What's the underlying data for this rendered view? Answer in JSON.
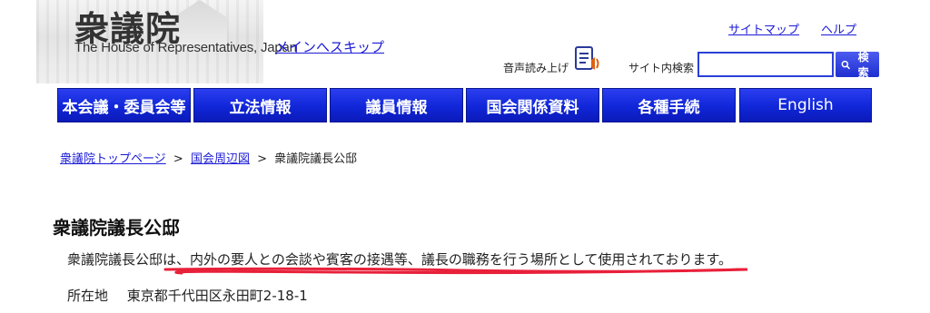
{
  "header": {
    "logo_kanji": "衆議院",
    "logo_en": "The House of Representatives, Japan",
    "skip_link": "メインへスキップ",
    "sitemap": "サイトマップ",
    "help": "ヘルプ",
    "speech_label": "音声読み上げ",
    "search_label": "サイト内検索",
    "search_value": "",
    "search_button": "検索"
  },
  "nav": {
    "items": [
      {
        "label": "本会議・委員会等"
      },
      {
        "label": "立法情報"
      },
      {
        "label": "議員情報"
      },
      {
        "label": "国会関係資料"
      },
      {
        "label": "各種手続"
      },
      {
        "label": "English"
      }
    ]
  },
  "breadcrumb": {
    "items": [
      "衆議院トップページ",
      "国会周辺図"
    ],
    "separator": ">",
    "current": "衆議院議長公邸"
  },
  "content": {
    "title": "衆議院議長公邸",
    "description": "衆議院議長公邸は、内外の要人との会談や賓客の接遇等、議長の職務を行う場所として使用されております。",
    "address_label": "所在地",
    "address_value": "東京都千代田区永田町2-18-1"
  },
  "colors": {
    "nav_blue": "#1026d8",
    "link_blue": "#1a1ad6",
    "annotation_red": "#e8203a"
  }
}
